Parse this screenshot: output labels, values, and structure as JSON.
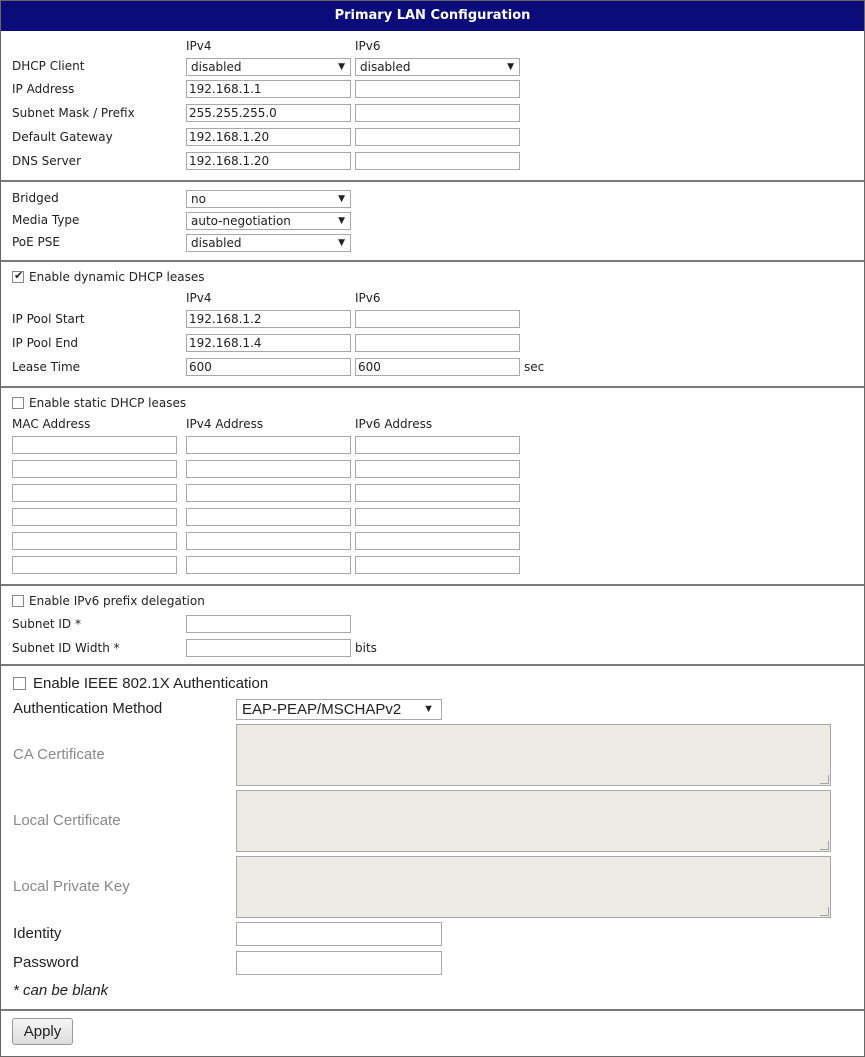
{
  "title": "Primary LAN Configuration",
  "ip_section": {
    "col_ipv4": "IPv4",
    "col_ipv6": "IPv6",
    "dhcp_client_label": "DHCP Client",
    "dhcp_client_ipv4": "disabled",
    "dhcp_client_ipv6": "disabled",
    "ip_address_label": "IP Address",
    "ip_address_ipv4": "192.168.1.1",
    "ip_address_ipv6": "",
    "subnet_label": "Subnet Mask / Prefix",
    "subnet_ipv4": "255.255.255.0",
    "subnet_ipv6": "",
    "gateway_label": "Default Gateway",
    "gateway_ipv4": "192.168.1.20",
    "gateway_ipv6": "",
    "dns_label": "DNS Server",
    "dns_ipv4": "192.168.1.20",
    "dns_ipv6": ""
  },
  "link_section": {
    "bridged_label": "Bridged",
    "bridged_value": "no",
    "media_label": "Media Type",
    "media_value": "auto-negotiation",
    "poe_label": "PoE PSE",
    "poe_value": "disabled"
  },
  "dynamic_dhcp": {
    "enable_label": "Enable dynamic DHCP leases",
    "enabled": true,
    "col_ipv4": "IPv4",
    "col_ipv6": "IPv6",
    "pool_start_label": "IP Pool Start",
    "pool_start_ipv4": "192.168.1.2",
    "pool_start_ipv6": "",
    "pool_end_label": "IP Pool End",
    "pool_end_ipv4": "192.168.1.4",
    "pool_end_ipv6": "",
    "lease_label": "Lease Time",
    "lease_ipv4": "600",
    "lease_ipv6": "600",
    "lease_unit": "sec"
  },
  "static_dhcp": {
    "enable_label": "Enable static DHCP leases",
    "enabled": false,
    "col_mac": "MAC Address",
    "col_ipv4": "IPv4 Address",
    "col_ipv6": "IPv6 Address",
    "rows": [
      {
        "mac": "",
        "ipv4": "",
        "ipv6": ""
      },
      {
        "mac": "",
        "ipv4": "",
        "ipv6": ""
      },
      {
        "mac": "",
        "ipv4": "",
        "ipv6": ""
      },
      {
        "mac": "",
        "ipv4": "",
        "ipv6": ""
      },
      {
        "mac": "",
        "ipv4": "",
        "ipv6": ""
      },
      {
        "mac": "",
        "ipv4": "",
        "ipv6": ""
      }
    ]
  },
  "prefix_delegation": {
    "enable_label": "Enable IPv6 prefix delegation",
    "enabled": false,
    "subnet_id_label": "Subnet ID *",
    "subnet_id_value": "",
    "subnet_width_label": "Subnet ID Width *",
    "subnet_width_value": "",
    "subnet_width_unit": "bits"
  },
  "ieee8021x": {
    "enable_label": "Enable IEEE 802.1X Authentication",
    "enabled": false,
    "auth_method_label": "Authentication Method",
    "auth_method_value": "EAP-PEAP/MSCHAPv2",
    "ca_cert_label": "CA Certificate",
    "local_cert_label": "Local Certificate",
    "private_key_label": "Local Private Key",
    "identity_label": "Identity",
    "identity_value": "",
    "password_label": "Password",
    "password_value": "",
    "note": "* can be blank"
  },
  "apply_label": "Apply",
  "colors": {
    "header_bg": "#0b0b7a",
    "header_text": "#ffffff",
    "separator": "#7a7a7a",
    "disabled_text": "#8a8a8a",
    "textarea_bg": "#ebeae4"
  }
}
